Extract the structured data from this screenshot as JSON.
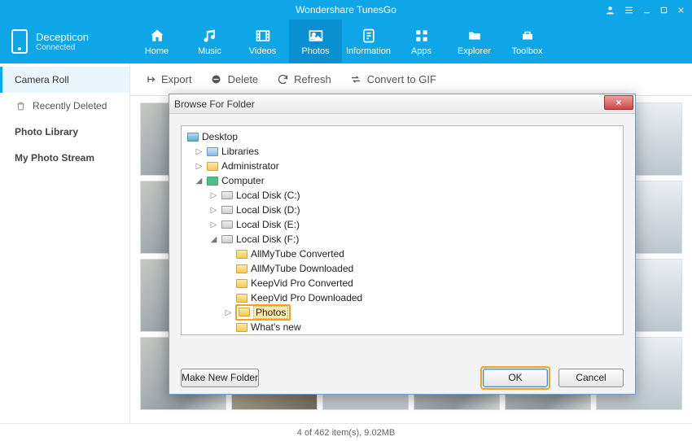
{
  "app": {
    "title": "Wondershare TunesGo"
  },
  "device": {
    "name": "Decepticon",
    "status": "Connected"
  },
  "nav": {
    "items": [
      {
        "label": "Home"
      },
      {
        "label": "Music"
      },
      {
        "label": "Videos"
      },
      {
        "label": "Photos"
      },
      {
        "label": "Information"
      },
      {
        "label": "Apps"
      },
      {
        "label": "Explorer"
      },
      {
        "label": "Toolbox"
      }
    ],
    "active_index": 3
  },
  "sidebar": {
    "items": [
      {
        "label": "Camera Roll"
      },
      {
        "label": "Recently Deleted"
      },
      {
        "label": "Photo Library"
      },
      {
        "label": "My Photo Stream"
      }
    ],
    "active_index": 0
  },
  "toolbar": {
    "export": "Export",
    "delete": "Delete",
    "refresh": "Refresh",
    "convert": "Convert to GIF"
  },
  "status": {
    "text": "4 of 462 item(s), 9.02MB"
  },
  "dialog": {
    "title": "Browse For Folder",
    "make_new": "Make New Folder",
    "ok": "OK",
    "cancel": "Cancel",
    "tree": {
      "desktop": "Desktop",
      "libraries": "Libraries",
      "administrator": "Administrator",
      "computer": "Computer",
      "drive_c": "Local Disk (C:)",
      "drive_d": "Local Disk (D:)",
      "drive_e": "Local Disk (E:)",
      "drive_f": "Local Disk (F:)",
      "f_children": [
        "AllMyTube Converted",
        "AllMyTube Downloaded",
        "KeepVid Pro Converted",
        "KeepVid Pro Downloaded",
        "Photos",
        "What's new"
      ],
      "selected": "Photos"
    }
  }
}
